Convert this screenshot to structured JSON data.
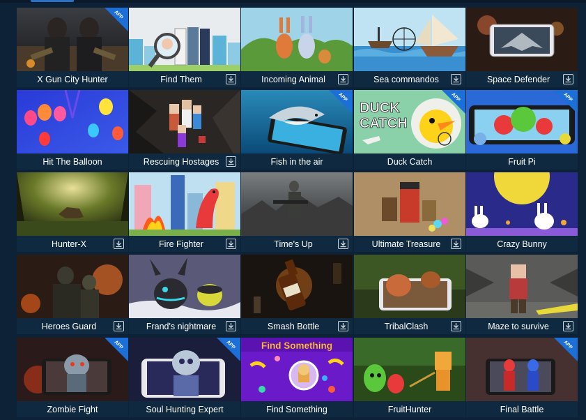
{
  "ribbon_text": "APP",
  "accent_color": "#2a6fc0",
  "games": [
    {
      "title": "X Gun City Hunter",
      "app": true,
      "download": false,
      "download_icon": "download-icon"
    },
    {
      "title": "Find Them",
      "app": false,
      "download": true,
      "download_icon": "download-icon"
    },
    {
      "title": "Incoming Animal",
      "app": false,
      "download": true,
      "download_icon": "download-icon"
    },
    {
      "title": "Sea commandos",
      "app": false,
      "download": true,
      "download_icon": "download-icon"
    },
    {
      "title": "Space Defender",
      "app": false,
      "download": true,
      "download_icon": "download-icon"
    },
    {
      "title": "Hit The Balloon",
      "app": false,
      "download": false,
      "download_icon": "download-icon"
    },
    {
      "title": "Rescuing Hostages",
      "app": false,
      "download": true,
      "download_icon": "download-icon"
    },
    {
      "title": "Fish in the air",
      "app": true,
      "download": false,
      "download_icon": "download-icon"
    },
    {
      "title": "Duck Catch",
      "app": true,
      "download": false,
      "download_icon": "download-icon"
    },
    {
      "title": "Fruit Pi",
      "app": true,
      "download": false,
      "download_icon": "download-icon"
    },
    {
      "title": "Hunter-X",
      "app": false,
      "download": true,
      "download_icon": "download-icon"
    },
    {
      "title": "Fire Fighter",
      "app": false,
      "download": true,
      "download_icon": "download-icon"
    },
    {
      "title": "Time's Up",
      "app": false,
      "download": true,
      "download_icon": "download-icon"
    },
    {
      "title": "Ultimate Treasure",
      "app": false,
      "download": true,
      "download_icon": "download-icon"
    },
    {
      "title": "Crazy Bunny",
      "app": false,
      "download": false,
      "download_icon": "download-icon"
    },
    {
      "title": "Heroes Guard",
      "app": false,
      "download": true,
      "download_icon": "download-icon"
    },
    {
      "title": "Frand's nightmare",
      "app": false,
      "download": true,
      "download_icon": "download-icon"
    },
    {
      "title": "Smash Bottle",
      "app": false,
      "download": true,
      "download_icon": "download-icon"
    },
    {
      "title": "TribalClash",
      "app": false,
      "download": true,
      "download_icon": "download-icon"
    },
    {
      "title": "Maze to survive",
      "app": false,
      "download": true,
      "download_icon": "download-icon"
    },
    {
      "title": "Zombie Fight",
      "app": true,
      "download": false,
      "download_icon": "download-icon"
    },
    {
      "title": "Soul Hunting Expert",
      "app": true,
      "download": false,
      "download_icon": "download-icon"
    },
    {
      "title": "Find Something",
      "app": false,
      "download": false,
      "download_icon": "download-icon",
      "thumb_text": "Find Something"
    },
    {
      "title": "FruitHunter",
      "app": false,
      "download": false,
      "download_icon": "download-icon"
    },
    {
      "title": "Final Battle",
      "app": true,
      "download": false,
      "download_icon": "download-icon"
    }
  ],
  "duck_catch_thumb_text": [
    "DUCK",
    "CATCH"
  ]
}
